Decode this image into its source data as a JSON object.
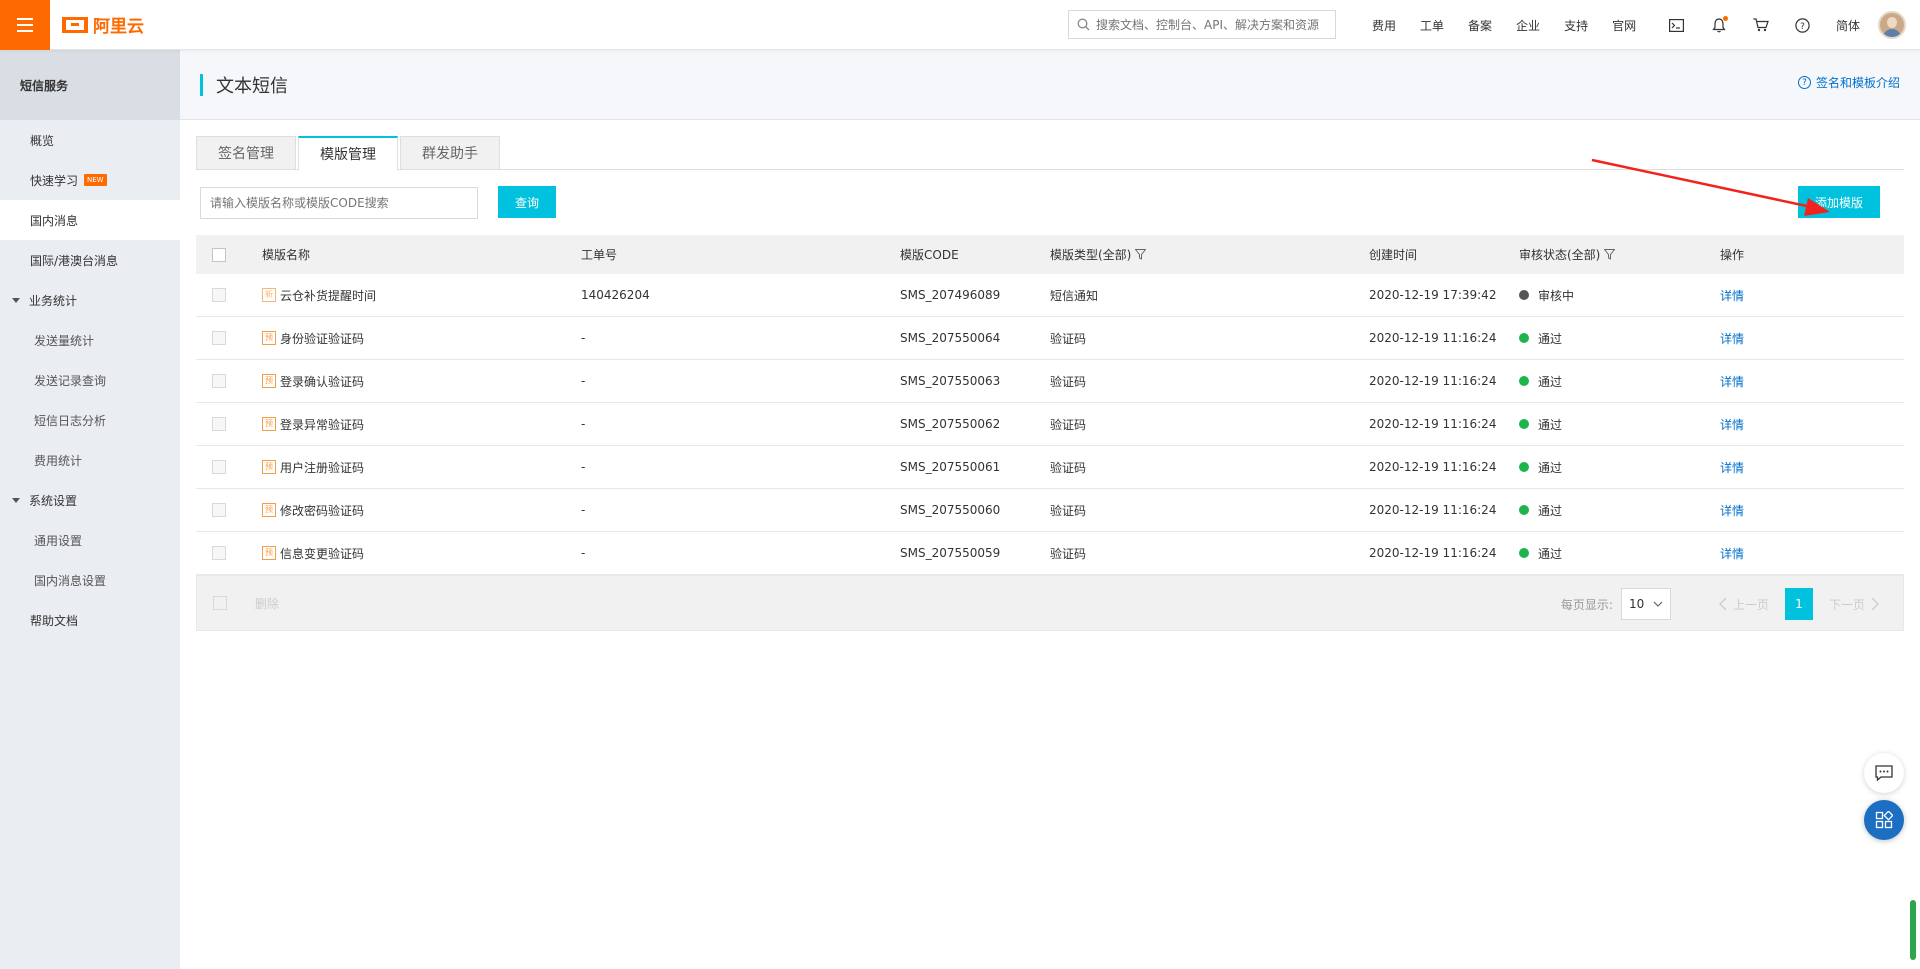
{
  "brand": {
    "name": "阿里云",
    "color": "#ff6a00"
  },
  "topbar": {
    "search_placeholder": "搜索文档、控制台、API、解决方案和资源",
    "nav": [
      "费用",
      "工单",
      "备案",
      "企业",
      "支持",
      "官网"
    ],
    "icons": [
      "terminal-icon",
      "bell-icon",
      "cart-icon",
      "help-icon"
    ],
    "lang": "简体"
  },
  "sidebar": {
    "title": "短信服务",
    "items": [
      {
        "label": "概览"
      },
      {
        "label": "快速学习",
        "badge": "NEW"
      },
      {
        "label": "国内消息",
        "active": true
      },
      {
        "label": "国际/港澳台消息"
      }
    ],
    "groups": [
      {
        "label": "业务统计",
        "children": [
          "发送量统计",
          "发送记录查询",
          "短信日志分析",
          "费用统计"
        ]
      },
      {
        "label": "系统设置",
        "children": [
          "通用设置",
          "国内消息设置"
        ]
      }
    ],
    "footer_item": "帮助文档"
  },
  "page": {
    "title": "文本短信",
    "help_link": "签名和模板介绍",
    "tabs": [
      "签名管理",
      "模版管理",
      "群发助手"
    ],
    "active_tab": 1,
    "search_placeholder": "请输入模版名称或模版CODE搜索",
    "query_button": "查询",
    "add_button": "添加模版"
  },
  "table": {
    "columns": [
      "模版名称",
      "工单号",
      "模版CODE",
      "模版类型(全部)",
      "创建时间",
      "审核状态(全部)",
      "操作"
    ],
    "rows": [
      {
        "tag": "新",
        "name": "云仓补货提醒时间",
        "ticket": "140426204",
        "code": "SMS_207496089",
        "type": "短信通知",
        "created": "2020-12-19 17:39:42",
        "status": "审核中",
        "status_kind": "pending",
        "op": "详情"
      },
      {
        "tag": "预",
        "name": "身份验证验证码",
        "ticket": "-",
        "code": "SMS_207550064",
        "type": "验证码",
        "created": "2020-12-19 11:16:24",
        "status": "通过",
        "status_kind": "pass",
        "op": "详情"
      },
      {
        "tag": "预",
        "name": "登录确认验证码",
        "ticket": "-",
        "code": "SMS_207550063",
        "type": "验证码",
        "created": "2020-12-19 11:16:24",
        "status": "通过",
        "status_kind": "pass",
        "op": "详情"
      },
      {
        "tag": "预",
        "name": "登录异常验证码",
        "ticket": "-",
        "code": "SMS_207550062",
        "type": "验证码",
        "created": "2020-12-19 11:16:24",
        "status": "通过",
        "status_kind": "pass",
        "op": "详情"
      },
      {
        "tag": "预",
        "name": "用户注册验证码",
        "ticket": "-",
        "code": "SMS_207550061",
        "type": "验证码",
        "created": "2020-12-19 11:16:24",
        "status": "通过",
        "status_kind": "pass",
        "op": "详情"
      },
      {
        "tag": "预",
        "name": "修改密码验证码",
        "ticket": "-",
        "code": "SMS_207550060",
        "type": "验证码",
        "created": "2020-12-19 11:16:24",
        "status": "通过",
        "status_kind": "pass",
        "op": "详情"
      },
      {
        "tag": "预",
        "name": "信息变更验证码",
        "ticket": "-",
        "code": "SMS_207550059",
        "type": "验证码",
        "created": "2020-12-19 11:16:24",
        "status": "通过",
        "status_kind": "pass",
        "op": "详情"
      }
    ],
    "footer": {
      "delete": "删除",
      "page_size_label": "每页显示:",
      "page_size": "10",
      "prev": "上一页",
      "next": "下一页",
      "current_page": "1"
    }
  },
  "colors": {
    "accent": "#00c1de",
    "link": "#0070cc",
    "pass": "#1fb44a",
    "pending": "#555555"
  }
}
